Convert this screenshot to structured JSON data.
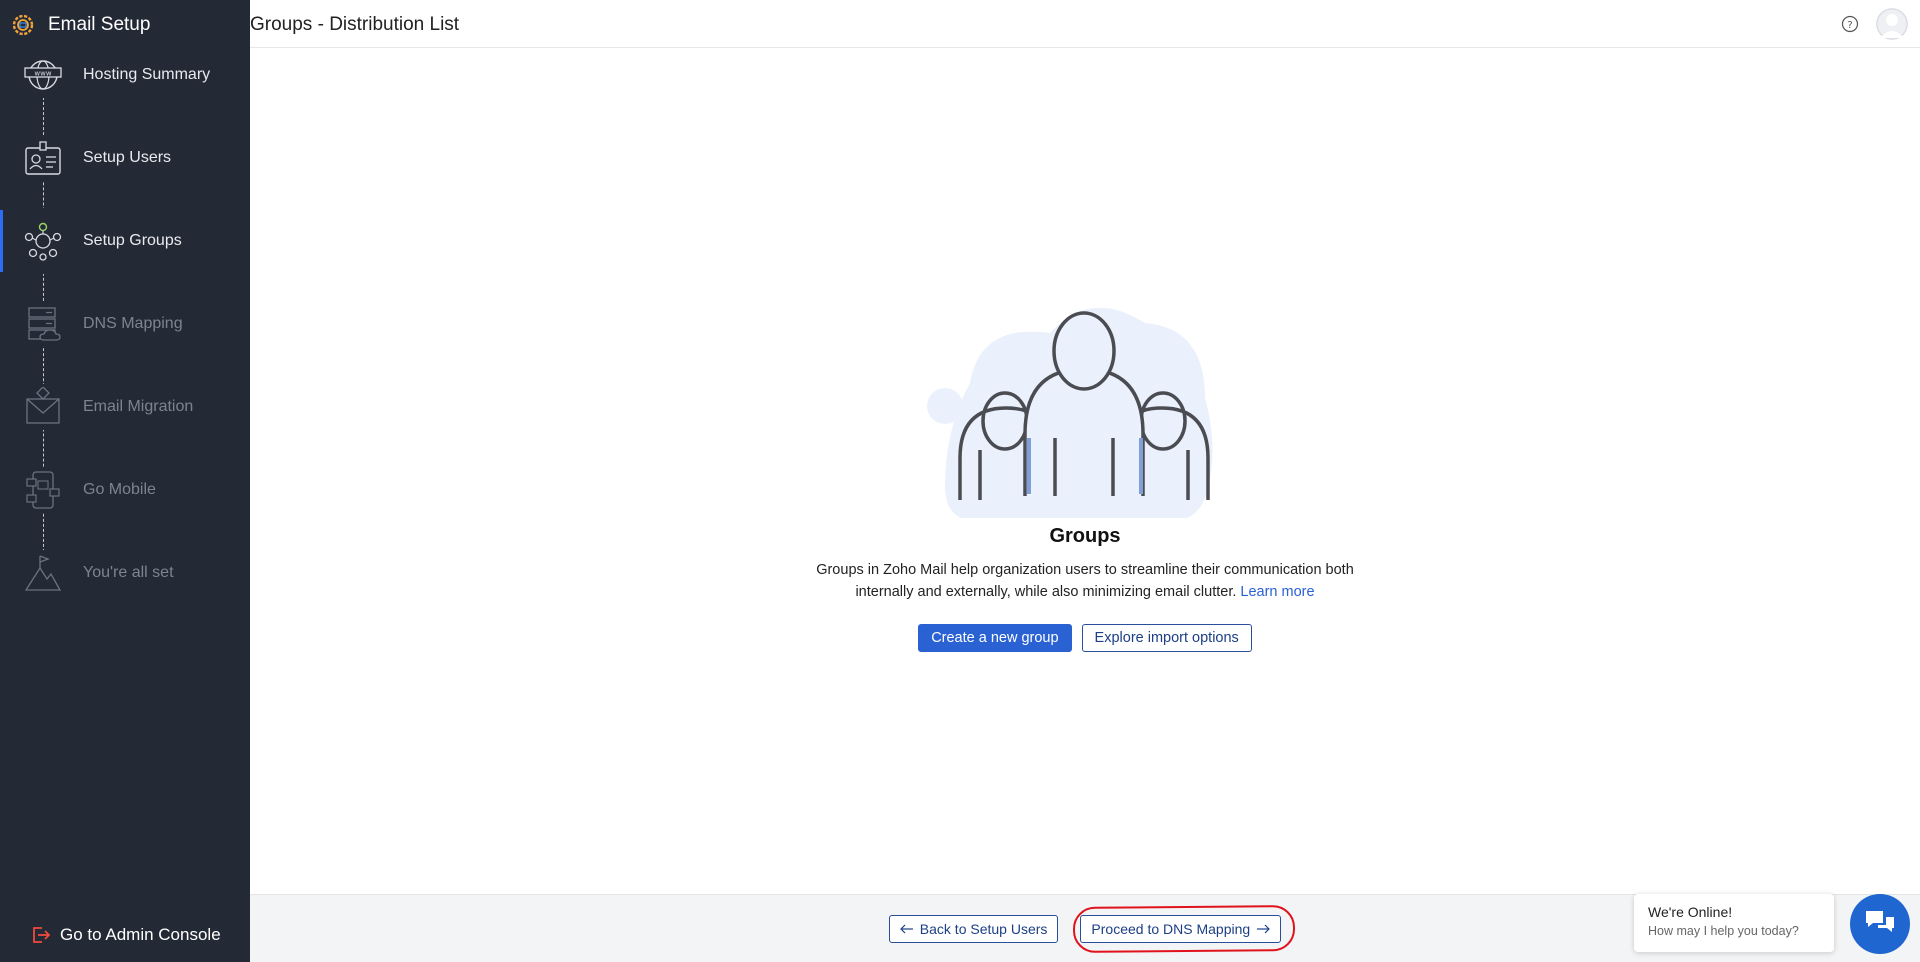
{
  "app": {
    "title": "Email Setup"
  },
  "header": {
    "title": "Groups - Distribution List"
  },
  "sidebar": {
    "steps": [
      {
        "label": "Hosting Summary",
        "icon": "globe-www-icon",
        "state": "done"
      },
      {
        "label": "Setup Users",
        "icon": "id-card-icon",
        "state": "done"
      },
      {
        "label": "Setup Groups",
        "icon": "group-network-icon",
        "state": "active"
      },
      {
        "label": "DNS Mapping",
        "icon": "server-cloud-icon",
        "state": "pending"
      },
      {
        "label": "Email Migration",
        "icon": "envelope-download-icon",
        "state": "pending"
      },
      {
        "label": "Go Mobile",
        "icon": "mobile-apps-icon",
        "state": "pending"
      },
      {
        "label": "You're all set",
        "icon": "mountain-flag-icon",
        "state": "pending"
      }
    ],
    "admin_link": "Go to Admin Console"
  },
  "empty_state": {
    "title": "Groups",
    "description": "Groups in Zoho Mail help organization users to streamline their communication both internally and externally, while also minimizing email clutter.",
    "learn_more": "Learn more",
    "primary_button": "Create a new group",
    "secondary_button": "Explore import options"
  },
  "footer": {
    "back_button": "Back to Setup Users",
    "next_button": "Proceed to DNS Mapping"
  },
  "chat": {
    "title": "We're Online!",
    "subtitle": "How may I help you today?"
  },
  "colors": {
    "sidebar_bg": "#232935",
    "accent": "#2a62d4",
    "highlight": "#e0121c"
  }
}
